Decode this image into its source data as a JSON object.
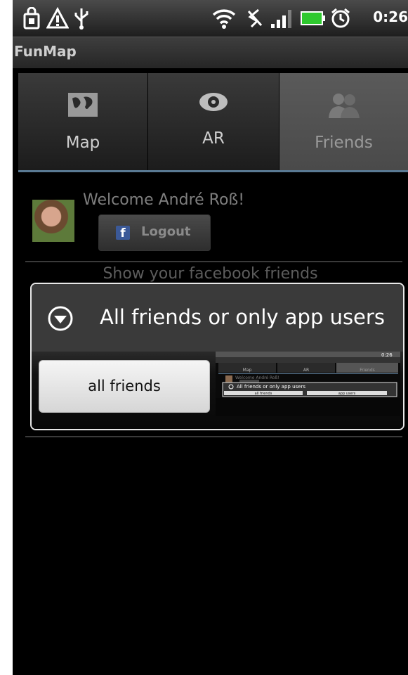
{
  "status_bar": {
    "clock": "0:26",
    "icons": [
      "shopping-bag-icon",
      "warning-icon",
      "usb-icon",
      "wifi-icon",
      "gps-off-icon",
      "signal-icon",
      "battery-icon",
      "alarm-icon"
    ]
  },
  "app": {
    "title": "FunMap"
  },
  "tabs": [
    {
      "label": "Map",
      "icon": "map-icon",
      "selected": false
    },
    {
      "label": "AR",
      "icon": "eye-icon",
      "selected": false
    },
    {
      "label": "Friends",
      "icon": "friends-icon",
      "selected": true
    }
  ],
  "welcome": {
    "text": "Welcome André Roß!",
    "logout_label": "Logout",
    "fb_letter": "f"
  },
  "show_friends": "Show your facebook friends",
  "dialog": {
    "title": "All friends or only app users",
    "choice": "all friends"
  },
  "thumbnail": {
    "clock": "0:26",
    "tabs": [
      "Map",
      "AR",
      "Friends"
    ],
    "welcome": "Welcome André Roß!",
    "dialog_title": "All friends or only app users",
    "buttons": [
      "all friends",
      "app users"
    ]
  },
  "colors": {
    "tab_underline": "#5a7a94",
    "facebook": "#3b5998"
  }
}
